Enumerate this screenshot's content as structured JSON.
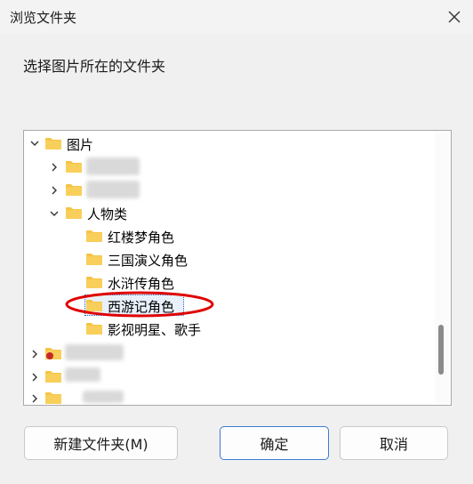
{
  "window": {
    "title": "浏览文件夹"
  },
  "prompt": "选择图片所在的文件夹",
  "tree": {
    "root": "图片",
    "group": "人物类",
    "children": [
      "红楼梦角色",
      "三国演义角色",
      "水浒传角色",
      "西游记角色",
      "影视明星、歌手"
    ],
    "selected": "西游记角色"
  },
  "buttons": {
    "new_folder": "新建文件夹(M)",
    "ok": "确定",
    "cancel": "取消"
  },
  "colors": {
    "folder": "#f6c445",
    "folder_dark": "#e3a21a",
    "highlight": "#e00000"
  }
}
